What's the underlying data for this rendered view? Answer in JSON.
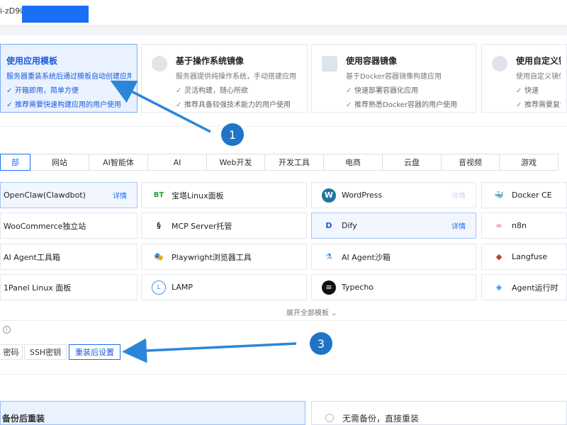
{
  "header": {
    "instance_id": "i-zD9i |"
  },
  "modes": [
    {
      "title": "使用应用模板",
      "desc": "服务器重装系统后通过模板自动创建应用",
      "features": [
        "开箱即用，简单方便",
        "推荐需要快速构建应用的用户使用"
      ]
    },
    {
      "title": "基于操作系统镜像",
      "desc": "服务器提供纯操作系统，手动搭建应用",
      "features": [
        "灵活构建，随心所欲",
        "推荐具备较强技术能力的用户使用"
      ]
    },
    {
      "title": "使用容器镜像",
      "desc": "基于Docker容器镜像构建应用",
      "features": [
        "快速部署容器化应用",
        "推荐熟悉Docker容器的用户使用"
      ]
    },
    {
      "title": "使用自定义镜像",
      "desc": "使用自定义镜像快速",
      "features": [
        "快速",
        "推荐需要复制、"
      ]
    }
  ],
  "tabs": [
    "部",
    "网站",
    "AI智能体",
    "AI",
    "Web开发",
    "开发工具",
    "电商",
    "云盘",
    "音视频",
    "游戏"
  ],
  "apps": [
    {
      "name": "OpenClaw(Clawdbot)",
      "detail": "详情",
      "icon": ""
    },
    {
      "name": "宝塔Linux面板",
      "icon": "BT"
    },
    {
      "name": "WordPress",
      "detail": "详情",
      "icon": "W"
    },
    {
      "name": "Docker CE",
      "icon": "🐳"
    },
    {
      "name": "WooCommerce独立站",
      "icon": ""
    },
    {
      "name": "MCP Server托管",
      "icon": "§"
    },
    {
      "name": "Dify",
      "detail": "详情",
      "icon": "D"
    },
    {
      "name": "n8n",
      "icon": "∞"
    },
    {
      "name": "AI Agent工具箱",
      "icon": ""
    },
    {
      "name": "Playwright浏览器工具",
      "icon": "🎭"
    },
    {
      "name": "AI Agent沙箱",
      "icon": "⚗"
    },
    {
      "name": "Langfuse",
      "icon": "◆"
    },
    {
      "name": "1Panel Linux 面板",
      "icon": ""
    },
    {
      "name": "LAMP",
      "icon": "L"
    },
    {
      "name": "Typecho",
      "icon": "≡"
    },
    {
      "name": "Agent运行时",
      "icon": "◈"
    }
  ],
  "expand_label": "展开全部模板 ⌄",
  "info_icon": "i",
  "auth_tabs": [
    "密码",
    "SSH密钥",
    "重装后设置"
  ],
  "backup": {
    "option1": "备份后重装",
    "option2": "无需备份，直接重装"
  },
  "annotations": {
    "badge1": "1",
    "badge3": "3"
  },
  "colors": {
    "accent": "#1a6ff5",
    "arrow": "#2b86d9",
    "badge": "#1f74c8"
  }
}
